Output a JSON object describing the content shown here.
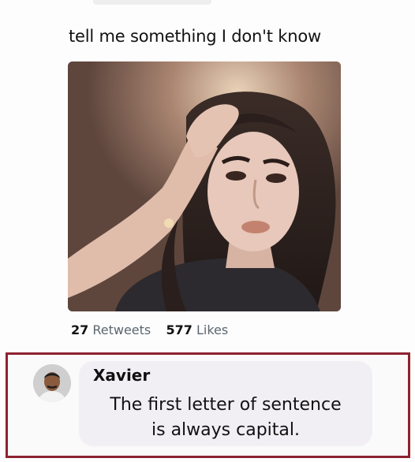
{
  "post": {
    "text": "tell me something I don't know",
    "photo_icon": "portrait-photo",
    "stats": {
      "retweets_count": "27",
      "retweets_label": "Retweets",
      "likes_count": "577",
      "likes_label": "Likes"
    }
  },
  "reply": {
    "name": "Xavier",
    "avatar_icon": "user-avatar",
    "text_line1": "The first letter of sentence",
    "text_line2": "is always capital."
  },
  "colors": {
    "frame_border": "#8e2230",
    "bubble_bg": "#f1eff4",
    "stat_label": "#5b6670"
  }
}
